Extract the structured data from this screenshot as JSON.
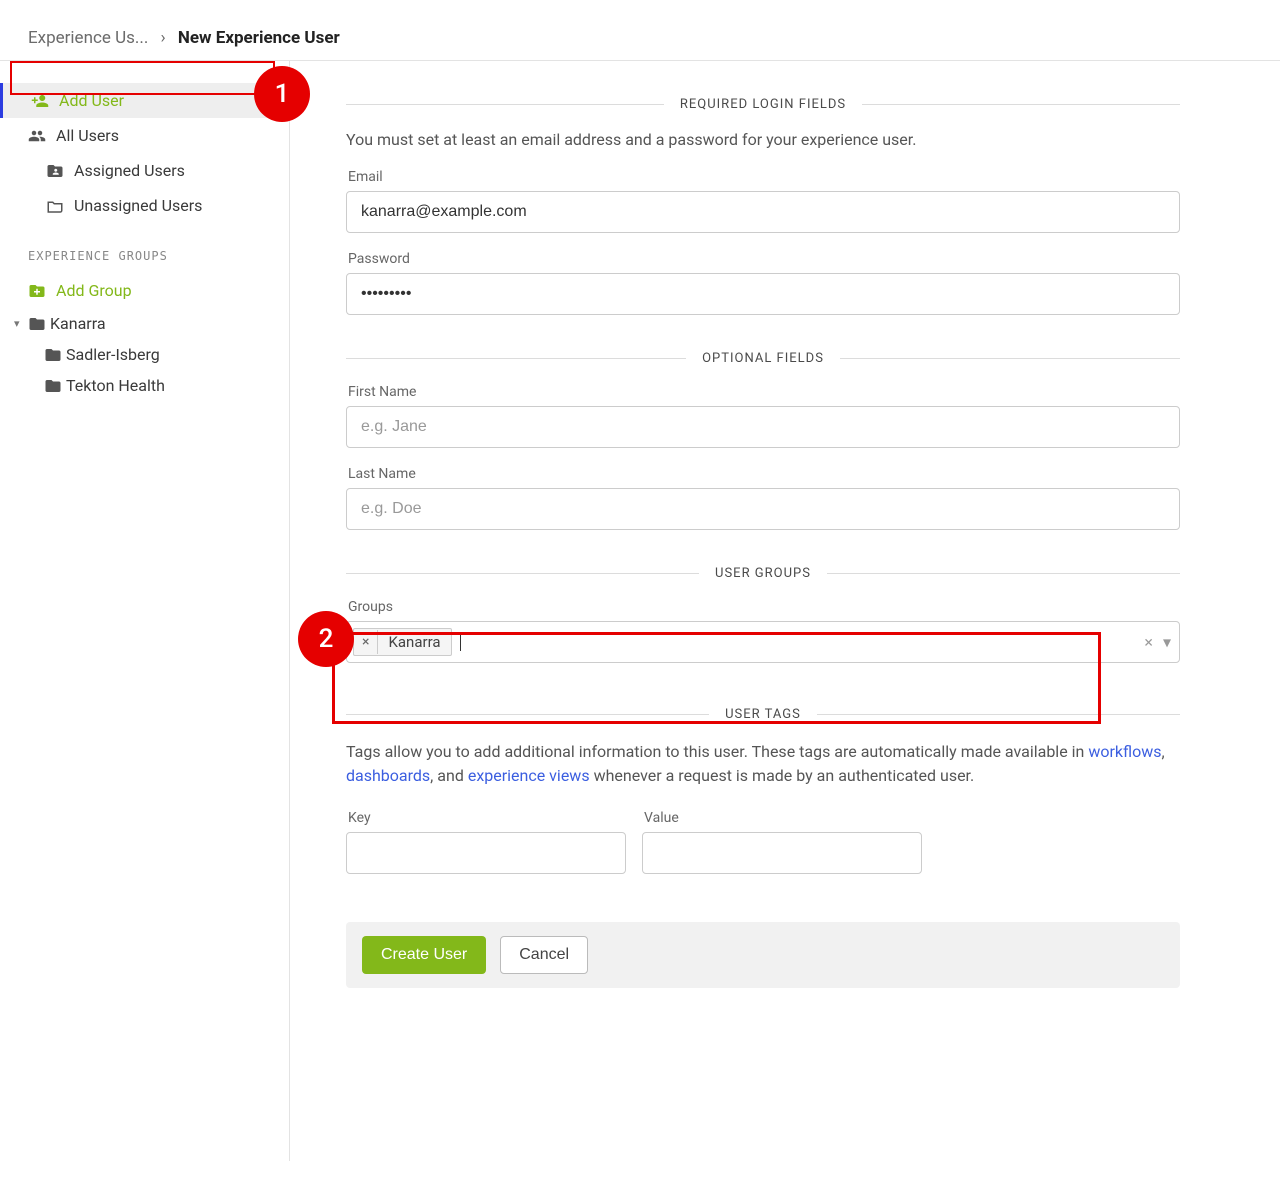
{
  "breadcrumb": {
    "parent": "Experience Us...",
    "current": "New Experience User"
  },
  "sidebar": {
    "add_user": "Add User",
    "all_users": "All Users",
    "assigned_users": "Assigned Users",
    "unassigned_users": "Unassigned Users",
    "groups_title": "EXPERIENCE GROUPS",
    "add_group": "Add Group",
    "tree": {
      "root": "Kanarra",
      "child1": "Sadler-Isberg",
      "child2": "Tekton Health"
    }
  },
  "annotations": {
    "step1": "1",
    "step2": "2"
  },
  "sections": {
    "required_login": "REQUIRED LOGIN FIELDS",
    "optional": "OPTIONAL FIELDS",
    "user_groups": "USER GROUPS",
    "user_tags": "USER TAGS"
  },
  "required_login_intro": "You must set at least an email address and a password for your experience user.",
  "fields": {
    "email_label": "Email",
    "email_value": "kanarra@example.com",
    "password_label": "Password",
    "password_value": "•••••••••",
    "first_name_label": "First Name",
    "first_name_placeholder": "e.g. Jane",
    "last_name_label": "Last Name",
    "last_name_placeholder": "e.g. Doe",
    "groups_label": "Groups",
    "groups_chip": "Kanarra",
    "key_label": "Key",
    "value_label": "Value"
  },
  "tags_intro": {
    "pre": "Tags allow you to add additional information to this user. These tags are automatically made available in ",
    "link1": "workflows",
    "sep1": ", ",
    "link2": "dashboards",
    "sep2": ", and ",
    "link3": "experience views",
    "post": " whenever a request is made by an authenticated user."
  },
  "buttons": {
    "create": "Create User",
    "cancel": "Cancel"
  }
}
